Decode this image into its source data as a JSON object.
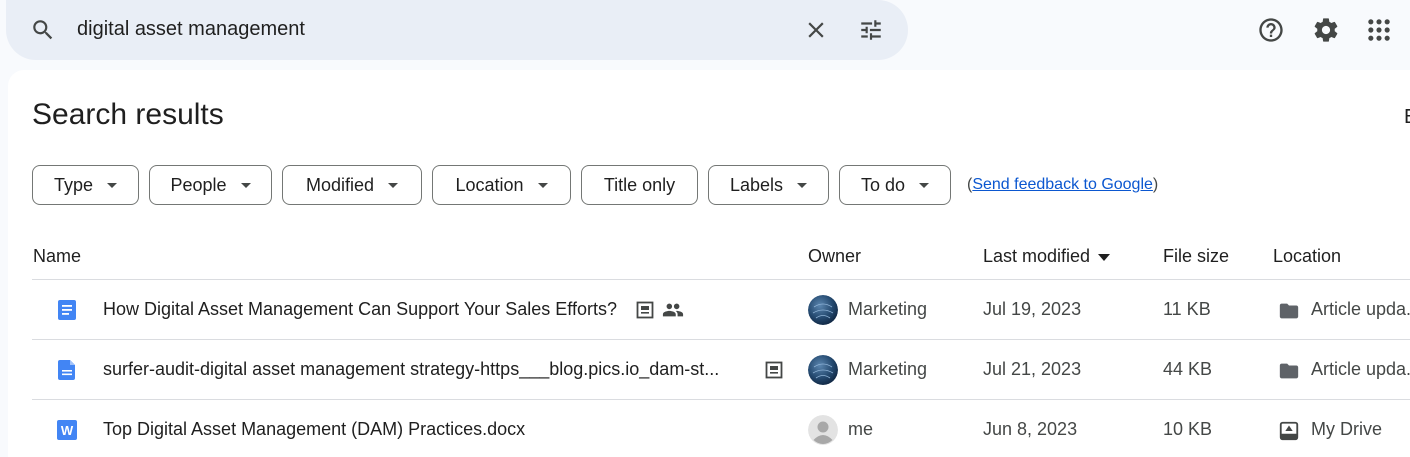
{
  "search": {
    "query": "digital asset management"
  },
  "page_title": "Search results",
  "edge_text": "E",
  "filters": [
    {
      "label": "Type"
    },
    {
      "label": "People"
    },
    {
      "label": "Modified"
    },
    {
      "label": "Location"
    },
    {
      "label": "Title only"
    },
    {
      "label": "Labels"
    },
    {
      "label": "To do"
    }
  ],
  "feedback": {
    "open": "(",
    "link": "Send feedback to Google",
    "close": ")"
  },
  "columns": {
    "name": "Name",
    "owner": "Owner",
    "last_modified": "Last modified",
    "file_size": "File size",
    "location": "Location"
  },
  "rows": [
    {
      "icon": "google-docs-icon",
      "name": "How Digital Asset Management Can Support Your Sales Efforts?",
      "owner": "Marketing",
      "modified": "Jul 19, 2023",
      "size": "11 KB",
      "location_icon": "folder-icon",
      "location": "Article upda..."
    },
    {
      "icon": "google-docs-icon",
      "name": "surfer-audit-digital asset management strategy-https___blog.pics.io_dam-st...",
      "owner": "Marketing",
      "modified": "Jul 21, 2023",
      "size": "44 KB",
      "location_icon": "folder-icon",
      "location": "Article upda..."
    },
    {
      "icon": "word-doc-icon",
      "name": "Top Digital Asset Management (DAM) Practices.docx",
      "owner": "me",
      "modified": "Jun 8, 2023",
      "size": "10 KB",
      "location_icon": "my-drive-icon",
      "location": "My Drive"
    }
  ],
  "colors": {
    "search_bg": "#e9eef6",
    "accent_blue": "#4285f4",
    "link": "#0b57d0"
  }
}
